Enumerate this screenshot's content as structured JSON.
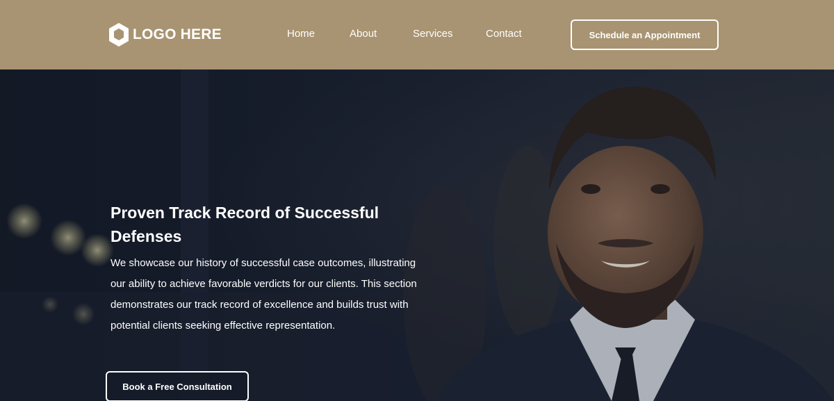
{
  "header": {
    "logo_text": "LOGO HERE",
    "logo_icon": "hexagon-logo-icon",
    "background_color": "#a89472",
    "nav": [
      {
        "label": "Home"
      },
      {
        "label": "About"
      },
      {
        "label": "Services"
      },
      {
        "label": "Contact"
      }
    ],
    "cta_label": "Schedule an Appointment"
  },
  "hero": {
    "title": "Proven Track Record of Successful Defenses",
    "description": "We showcase our history of successful case outcomes, illustrating our ability to achieve favorable verdicts for our clients. This section demonstrates our track record of excellence and builds trust with potential clients seeking effective representation.",
    "cta_label": "Book a Free Consultation",
    "image": "smiling-man-in-suit-photo"
  }
}
